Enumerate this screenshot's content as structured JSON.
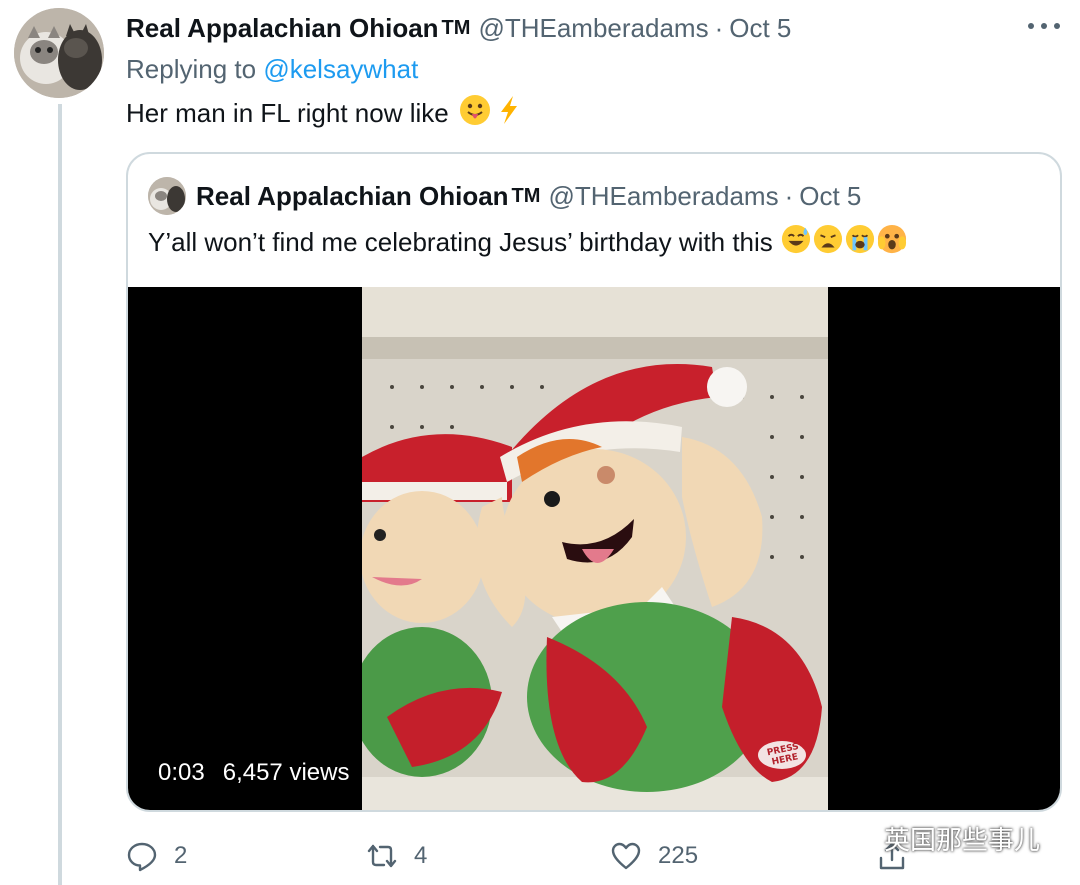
{
  "tweet": {
    "display_name": "Real Appalachian Ohioan",
    "tm_mark": "TM",
    "handle": "@THEamberadams",
    "separator": "·",
    "date": "Oct 5",
    "replying_to_prefix": "Replying to",
    "replying_to_handle": "@kelsaywhat",
    "text": "Her man in FL right now like",
    "text_emojis": [
      "tongue-face-emoji",
      "lightning-emoji"
    ]
  },
  "quoted_tweet": {
    "display_name": "Real Appalachian Ohioan",
    "tm_mark": "TM",
    "handle": "@THEamberadams",
    "separator": "·",
    "date": "Oct 5",
    "text": "Y’all won’t find me celebrating Jesus’ birthday with this",
    "text_emojis": [
      "sweat-smile-emoji",
      "weary-emoji",
      "crying-emoji",
      "scared-emoji"
    ],
    "video": {
      "time": "0:03",
      "views": "6,457 views",
      "elf_label": "PRESS HERE"
    }
  },
  "actions": {
    "reply_count": "2",
    "retweet_count": "4",
    "like_count": "225"
  },
  "watermark": {
    "text": "英国那些事儿"
  },
  "colors": {
    "text_primary": "#0f1419",
    "text_secondary": "#536471",
    "link": "#1d9bf0",
    "border": "#cfd9de"
  }
}
